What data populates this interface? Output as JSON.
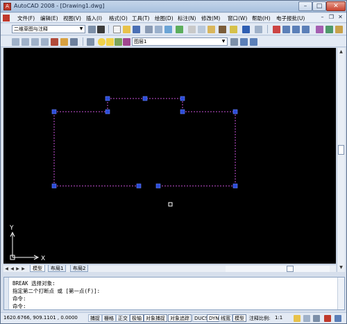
{
  "window": {
    "title": "AutoCAD 2008 - [Drawing1.dwg]"
  },
  "menu": {
    "items": [
      "文件(F)",
      "编辑(E)",
      "视图(V)",
      "插入(I)",
      "格式(O)",
      "工具(T)",
      "绘图(D)",
      "标注(N)",
      "修改(M)",
      "窗口(W)",
      "帮助(H)",
      "电子报批(U)"
    ]
  },
  "toolbar": {
    "workspace": "二维草图与注释",
    "layer": "图层1"
  },
  "colors": {
    "canvas": "#000000",
    "grip": "#2a4bd7",
    "dash": "#c84fd8",
    "accent": "#c0392b"
  },
  "layout_tabs": [
    "模型",
    "布局1",
    "布局2"
  ],
  "ucs": {
    "x_label": "X",
    "y_label": "Y"
  },
  "command": {
    "lines": [
      "BREAK 选择对象:",
      "指定第二个打断点 或 [第一点(F)]:",
      "命令:",
      "命令:"
    ]
  },
  "status": {
    "coords": "1620.6766, 909.1101 , 0.0000",
    "toggles": [
      "捕捉",
      "栅格",
      "正交",
      "极轴",
      "对象捕捉",
      "对象追踪",
      "DUCS",
      "DYN",
      "线宽",
      "模型"
    ],
    "annotation_scale_label": "注释比例:",
    "annotation_scale": "1:1"
  }
}
